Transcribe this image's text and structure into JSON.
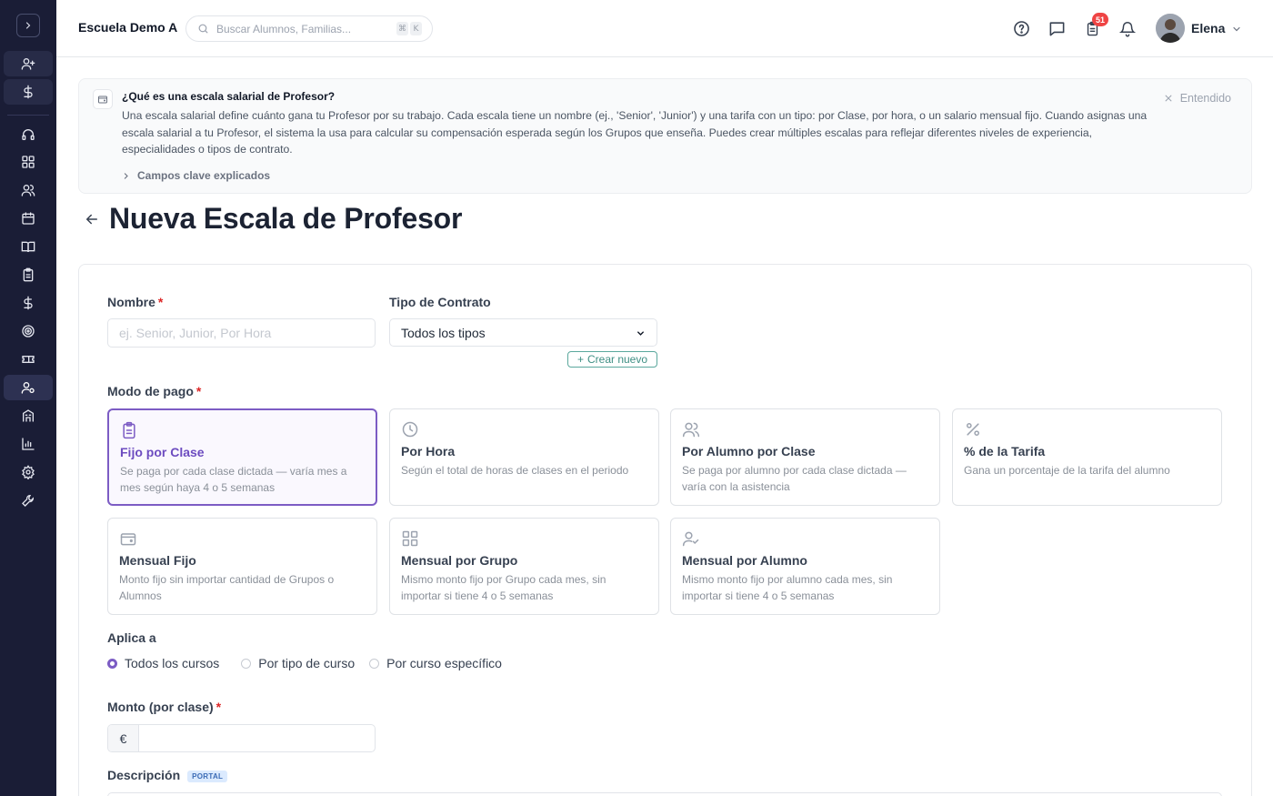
{
  "colors": {
    "sidebar_bg": "#1a1d36",
    "accent": "#7c5cc4",
    "teal": "#3f8f84",
    "badge_red": "#ef4444",
    "required": "#dc2626"
  },
  "sidebar": {
    "items": [
      {
        "icon": "add-user-icon"
      },
      {
        "icon": "dollar-icon"
      },
      {
        "icon": "headset-icon"
      },
      {
        "icon": "grid-icon"
      },
      {
        "icon": "users-icon"
      },
      {
        "icon": "calendar-icon"
      },
      {
        "icon": "book-icon"
      },
      {
        "icon": "clipboard-icon"
      },
      {
        "icon": "dollar-icon"
      },
      {
        "icon": "target-icon"
      },
      {
        "icon": "ticket-icon"
      },
      {
        "icon": "user-settings-icon"
      },
      {
        "icon": "building-icon"
      },
      {
        "icon": "bar-chart-icon"
      },
      {
        "icon": "gear-icon"
      },
      {
        "icon": "wrench-icon"
      }
    ]
  },
  "header": {
    "school_name": "Escuela Demo A",
    "search_placeholder": "Buscar Alumnos, Familias...",
    "kbd_1": "⌘",
    "kbd_2": "K",
    "tasks_badge": "51",
    "user_name": "Elena"
  },
  "banner": {
    "title": "¿Qué es una escala salarial de Profesor?",
    "text": "Una escala salarial define cuánto gana tu Profesor por su trabajo. Cada escala tiene un nombre (ej., 'Senior', 'Junior') y una tarifa con un tipo: por Clase, por hora, o un salario mensual fijo. Cuando asignas una escala salarial a tu Profesor, el sistema la usa para calcular su compensación esperada según los Grupos que enseña. Puedes crear múltiples escalas para reflejar diferentes niveles de experiencia, especialidades o tipos de contrato.",
    "dismiss_label": "Entendido",
    "expand_label": "Campos clave explicados"
  },
  "page": {
    "title": "Nueva Escala de Profesor"
  },
  "form": {
    "nombre_label": "Nombre",
    "nombre_placeholder": "ej. Senior, Junior, Por Hora",
    "contrato_label": "Tipo de Contrato",
    "contrato_value": "Todos los tipos",
    "crear_nuevo": "Crear nuevo",
    "modo_label": "Modo de pago",
    "modes": [
      {
        "title": "Fijo por Clase",
        "desc": "Se paga por cada clase dictada — varía mes a mes según haya 4 o 5 semanas",
        "selected": true,
        "icon": "clipboard-icon"
      },
      {
        "title": "Por Hora",
        "desc": "Según el total de horas de clases en el periodo",
        "selected": false,
        "icon": "clock-icon"
      },
      {
        "title": "Por Alumno por Clase",
        "desc": "Se paga por alumno por cada clase dictada — varía con la asistencia",
        "selected": false,
        "icon": "users-icon"
      },
      {
        "title": "% de la Tarifa",
        "desc": "Gana un porcentaje de la tarifa del alumno",
        "selected": false,
        "icon": "percent-icon"
      },
      {
        "title": "Mensual Fijo",
        "desc": "Monto fijo sin importar cantidad de Grupos o Alumnos",
        "selected": false,
        "icon": "wallet-icon"
      },
      {
        "title": "Mensual por Grupo",
        "desc": "Mismo monto fijo por Grupo cada mes, sin importar si tiene 4 o 5 semanas",
        "selected": false,
        "icon": "grid-icon"
      },
      {
        "title": "Mensual por Alumno",
        "desc": "Mismo monto fijo por alumno cada mes, sin importar si tiene 4 o 5 semanas",
        "selected": false,
        "icon": "user-check-icon"
      }
    ],
    "aplica_label": "Aplica a",
    "aplica_options": [
      {
        "label": "Todos los cursos",
        "selected": true
      },
      {
        "label": "Por tipo de curso",
        "selected": false
      },
      {
        "label": "Por curso específico",
        "selected": false
      }
    ],
    "monto_label": "Monto (por clase)",
    "currency_symbol": "€",
    "monto_value": "",
    "descripcion_label": "Descripción",
    "portal_badge": "PORTAL"
  }
}
